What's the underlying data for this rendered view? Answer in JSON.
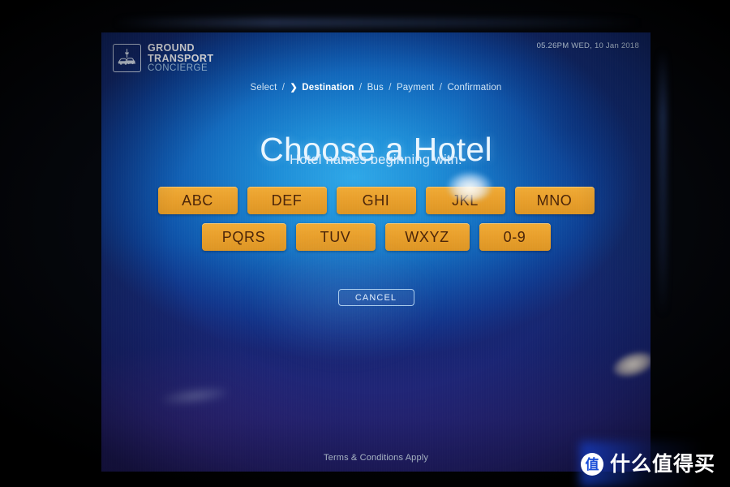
{
  "header": {
    "logo": {
      "icon": "airport-tower-and-cars-icon",
      "line1": "GROUND",
      "line2": "TRANSPORT",
      "line3": "CONCIERGE"
    },
    "timestamp": "05.26PM WED, 10 Jan 2018"
  },
  "breadcrumb": {
    "chevron": "❯",
    "separator": "/",
    "items": [
      {
        "label": "Select",
        "active": false
      },
      {
        "label": "Destination",
        "active": true
      },
      {
        "label": "Bus",
        "active": false
      },
      {
        "label": "Payment",
        "active": false
      },
      {
        "label": "Confirmation",
        "active": false
      }
    ]
  },
  "main": {
    "title": "Choose a Hotel",
    "subtitle": "Hotel names beginning with:",
    "keypad": {
      "row1": [
        "ABC",
        "DEF",
        "GHI",
        "JKL",
        "MNO"
      ],
      "row2": [
        "PQRS",
        "TUV",
        "WXYZ",
        "0-9"
      ]
    },
    "cancel_label": "CANCEL"
  },
  "footer": {
    "terms": "Terms & Conditions Apply"
  },
  "watermark": {
    "badge": "值",
    "text": "什么值得买"
  },
  "colors": {
    "key_background": "#e9a02c",
    "key_text": "#4a2408",
    "screen_blue": "#1f8fd8",
    "screen_deep": "#122a6e",
    "accent_text": "#ffffff"
  }
}
